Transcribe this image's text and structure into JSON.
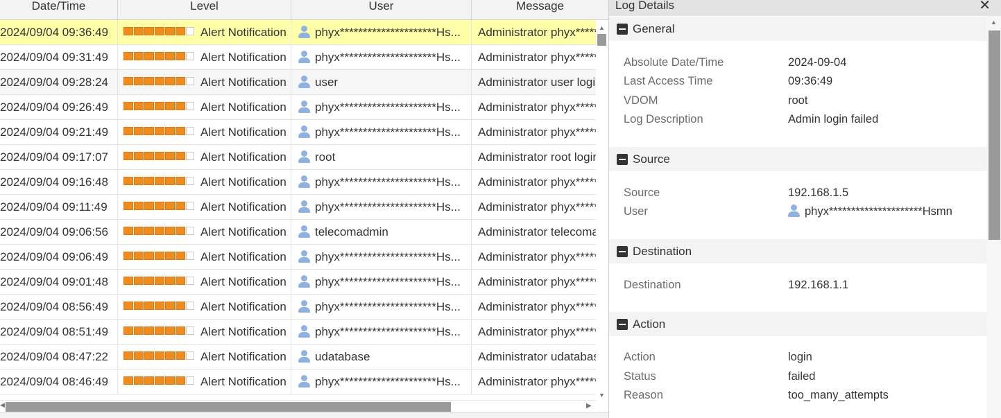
{
  "table": {
    "columns": [
      "Date/Time",
      "Level",
      "User",
      "Message"
    ],
    "rows": [
      {
        "datetime": "2024/09/04 09:36:49",
        "level": "Alert Notification",
        "user": "phyx*********************Hs...",
        "message": "Administrator phyx*****",
        "state": "selected"
      },
      {
        "datetime": "2024/09/04 09:31:49",
        "level": "Alert Notification",
        "user": "phyx*********************Hs...",
        "message": "Administrator phyx*****",
        "state": ""
      },
      {
        "datetime": "2024/09/04 09:28:24",
        "level": "Alert Notification",
        "user": "user",
        "message": "Administrator user login",
        "state": "alt"
      },
      {
        "datetime": "2024/09/04 09:26:49",
        "level": "Alert Notification",
        "user": "phyx*********************Hs...",
        "message": "Administrator phyx*****",
        "state": ""
      },
      {
        "datetime": "2024/09/04 09:21:49",
        "level": "Alert Notification",
        "user": "phyx*********************Hs...",
        "message": "Administrator phyx*****",
        "state": ""
      },
      {
        "datetime": "2024/09/04 09:17:07",
        "level": "Alert Notification",
        "user": "root",
        "message": "Administrator root login",
        "state": ""
      },
      {
        "datetime": "2024/09/04 09:16:48",
        "level": "Alert Notification",
        "user": "phyx*********************Hs...",
        "message": "Administrator phyx*****",
        "state": ""
      },
      {
        "datetime": "2024/09/04 09:11:49",
        "level": "Alert Notification",
        "user": "phyx*********************Hs...",
        "message": "Administrator phyx*****",
        "state": ""
      },
      {
        "datetime": "2024/09/04 09:06:56",
        "level": "Alert Notification",
        "user": "telecomadmin",
        "message": "Administrator telecomadmin",
        "state": ""
      },
      {
        "datetime": "2024/09/04 09:06:49",
        "level": "Alert Notification",
        "user": "phyx*********************Hs...",
        "message": "Administrator phyx*****",
        "state": ""
      },
      {
        "datetime": "2024/09/04 09:01:48",
        "level": "Alert Notification",
        "user": "phyx*********************Hs...",
        "message": "Administrator phyx*****",
        "state": ""
      },
      {
        "datetime": "2024/09/04 08:56:49",
        "level": "Alert Notification",
        "user": "phyx*********************Hs...",
        "message": "Administrator phyx*****",
        "state": ""
      },
      {
        "datetime": "2024/09/04 08:51:49",
        "level": "Alert Notification",
        "user": "phyx*********************Hs...",
        "message": "Administrator phyx*****",
        "state": ""
      },
      {
        "datetime": "2024/09/04 08:47:22",
        "level": "Alert Notification",
        "user": "udatabase",
        "message": "Administrator udatabase",
        "state": ""
      },
      {
        "datetime": "2024/09/04 08:46:49",
        "level": "Alert Notification",
        "user": "phyx*********************Hs...",
        "message": "Administrator phyx*****",
        "state": ""
      }
    ],
    "level_bars_filled": 6,
    "level_bars_total": 7
  },
  "details": {
    "title": "Log Details",
    "close_glyph": "✕",
    "sections": [
      {
        "title": "General",
        "fields": [
          {
            "key": "Absolute Date/Time",
            "value": "2024-09-04"
          },
          {
            "key": "Last Access Time",
            "value": "09:36:49"
          },
          {
            "key": "VDOM",
            "value": "root"
          },
          {
            "key": "Log Description",
            "value": "Admin login failed"
          }
        ]
      },
      {
        "title": "Source",
        "fields": [
          {
            "key": "Source",
            "value": "192.168.1.5"
          },
          {
            "key": "User",
            "value": "phyx*********************Hsmn",
            "icon": "user-icon"
          }
        ]
      },
      {
        "title": "Destination",
        "fields": [
          {
            "key": "Destination",
            "value": "192.168.1.1"
          }
        ]
      },
      {
        "title": "Action",
        "fields": [
          {
            "key": "Action",
            "value": "login"
          },
          {
            "key": "Status",
            "value": "failed"
          },
          {
            "key": "Reason",
            "value": "too_many_attempts"
          }
        ]
      }
    ]
  },
  "colors": {
    "selected_row": "#ffffa8",
    "level_bar": "#ef8c1d",
    "user_icon": "#8fb2e3"
  }
}
